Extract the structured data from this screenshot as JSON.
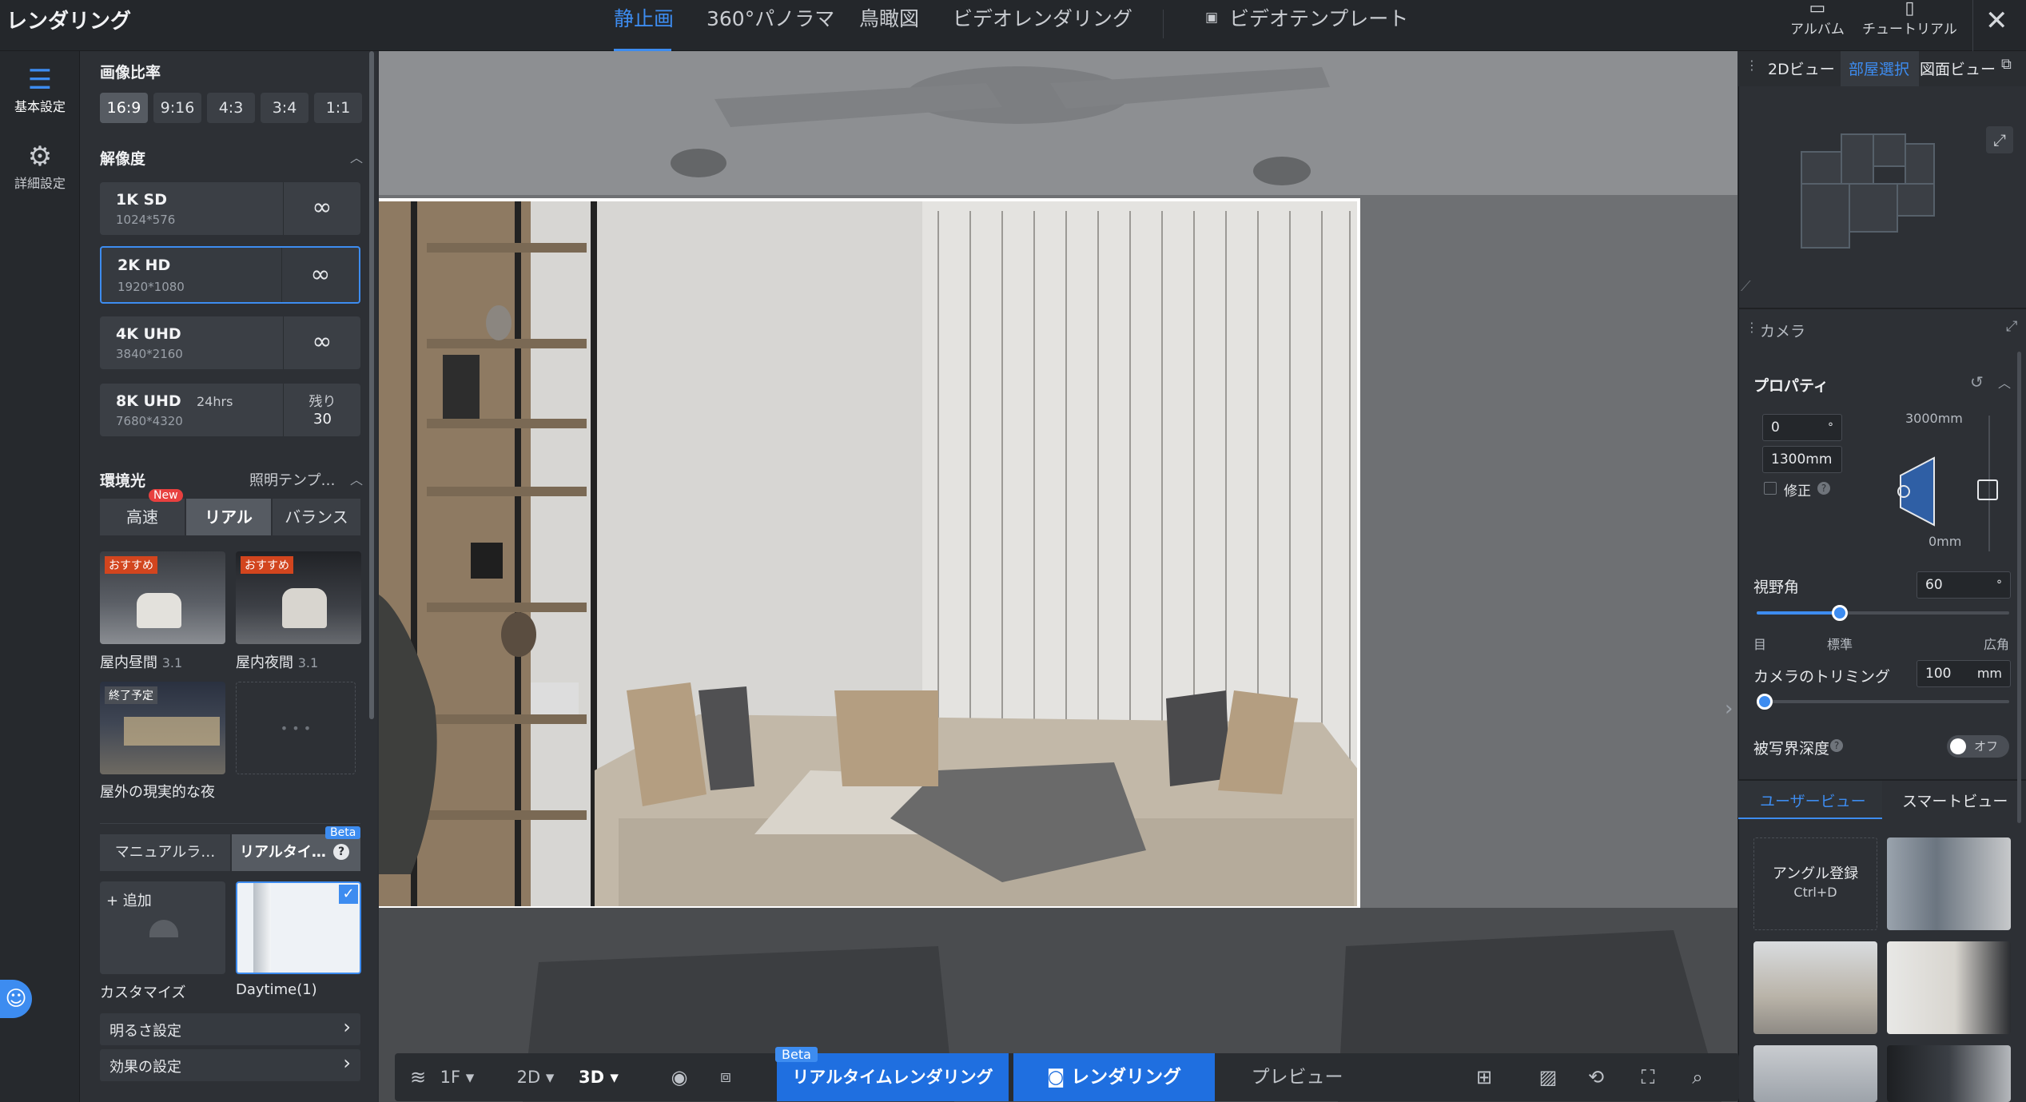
{
  "app": {
    "title": "レンダリング"
  },
  "tabs": [
    {
      "label": "静止画"
    },
    {
      "label": "360°パノラマ"
    },
    {
      "label": "鳥瞰図"
    },
    {
      "label": "ビデオレンダリング"
    },
    {
      "label": "ビデオテンプレート"
    }
  ],
  "top_right": {
    "album": "アルバム",
    "tutorial": "チュートリアル"
  },
  "rail": {
    "basic": "基本設定",
    "advanced": "詳細設定"
  },
  "left": {
    "aspect_title": "画像比率",
    "aspect_options": [
      "16:9",
      "9:16",
      "4:3",
      "3:4",
      "1:1"
    ],
    "aspect_selected": "16:9",
    "resolution_title": "解像度",
    "resolutions": [
      {
        "name": "1K SD",
        "dim": "1024*576",
        "right": "∞"
      },
      {
        "name": "2K HD",
        "dim": "1920*1080",
        "right": "∞"
      },
      {
        "name": "4K UHD",
        "dim": "3840*2160",
        "right": "∞"
      },
      {
        "name": "8K UHD",
        "badge": "24hrs",
        "dim": "7680*4320",
        "remain_label": "残り",
        "remain_value": "30"
      }
    ],
    "env_title": "環境光",
    "env_template": "照明テンプ…",
    "env_new": "New",
    "env_modes": [
      "高速",
      "リアル",
      "バランス"
    ],
    "env_mode_selected": "リアル",
    "presets": [
      {
        "tag": "おすすめ",
        "name": "屋内昼間",
        "ver": "3.1"
      },
      {
        "tag": "おすすめ",
        "name": "屋内夜間",
        "ver": "3.1"
      },
      {
        "tag": "終了予定",
        "name": "屋外の現実的な夜"
      }
    ],
    "more_dots": "• • •",
    "light_tabs": [
      "マニュアルラ…",
      "リアルタイ…"
    ],
    "light_tab_beta": "Beta",
    "add_label": "+ 追加",
    "custom_caption": "カスタマイズ",
    "daytime_caption": "Daytime(1)",
    "brightness": "明るさ設定",
    "effects": "効果の設定"
  },
  "right": {
    "tabs": [
      "2Dビュー",
      "部屋選択",
      "図面ビュー"
    ],
    "tab_selected": "部屋選択",
    "camera_title": "カメラ",
    "properties_title": "プロパティ",
    "angle_value": "0",
    "angle_unit": "°",
    "height_value": "1300mm",
    "fix_label": "修正",
    "range_top": "3000mm",
    "range_bottom": "0mm",
    "fov_label": "視野角",
    "fov_value": "60",
    "fov_unit": "°",
    "fov_fraction": 0.33,
    "fov_marks": [
      "目",
      "標準",
      "広角"
    ],
    "trim_label": "カメラのトリミング",
    "trim_value": "100",
    "trim_unit": "mm",
    "trim_fraction": 0.0,
    "dof_label": "被写界深度",
    "dof_state": "オフ",
    "view_tabs": [
      "ユーザービュー",
      "スマートビュー"
    ],
    "view_selected": "ユーザービュー",
    "angle_register": "アングル登録",
    "angle_shortcut": "Ctrl+D"
  },
  "bottom": {
    "floor": "1F",
    "mode2d": "2D",
    "mode3d": "3D",
    "realtime": "リアルタイムレンダリング",
    "realtime_beta": "Beta",
    "render": "レンダリング",
    "preview": "プレビュー"
  },
  "colors": {
    "accent": "#3d8cf0",
    "panel": "#2d3035",
    "topbar": "#24272b",
    "recommend": "#d2451e"
  }
}
